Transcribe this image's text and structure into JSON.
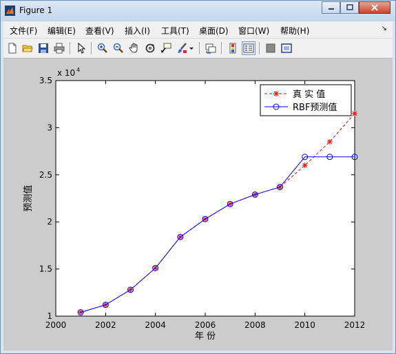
{
  "window": {
    "title": "Figure 1"
  },
  "menu": [
    "文件(F)",
    "编辑(E)",
    "查看(V)",
    "插入(I)",
    "工具(T)",
    "桌面(D)",
    "窗口(W)",
    "帮助(H)"
  ],
  "toolbar": [
    "new-figure",
    "open-file",
    "save",
    "print",
    "edit-plot",
    "zoom-in",
    "zoom-out",
    "pan",
    "rotate-3d",
    "data-cursor",
    "brush",
    "brush-menu",
    "link-plot",
    "insert-colorbar",
    "insert-legend",
    "hide-plot-tools",
    "show-plot-tools"
  ],
  "chart_data": {
    "type": "line",
    "xlabel": "年 份",
    "ylabel": "预测值",
    "y_exponent_label": "x 10",
    "y_exponent": "4",
    "xlim": [
      2000,
      2012
    ],
    "ylim": [
      10000,
      35000
    ],
    "x_ticks": [
      "2000",
      "2002",
      "2004",
      "2006",
      "2008",
      "2010",
      "2012"
    ],
    "y_ticks": [
      "1",
      "1.5",
      "2",
      "2.5",
      "3",
      "3.5"
    ],
    "legend_position": "top-right",
    "series": [
      {
        "name": "真 实 值",
        "style": "red dashed line with star markers",
        "color": "#ff0000",
        "x": [
          2001,
          2002,
          2003,
          2004,
          2005,
          2006,
          2007,
          2008,
          2009,
          2010,
          2011,
          2012
        ],
        "y": [
          10400,
          11200,
          12800,
          15100,
          18400,
          20300,
          21900,
          22900,
          23700,
          26000,
          28500,
          31500
        ]
      },
      {
        "name": "RBF预测值",
        "style": "blue solid line with circle markers",
        "color": "#0000ff",
        "x": [
          2001,
          2002,
          2003,
          2004,
          2005,
          2006,
          2007,
          2008,
          2009,
          2010,
          2011,
          2012
        ],
        "y": [
          10400,
          11200,
          12800,
          15100,
          18400,
          20300,
          21900,
          22900,
          23700,
          26900,
          26900,
          26900
        ]
      }
    ]
  }
}
